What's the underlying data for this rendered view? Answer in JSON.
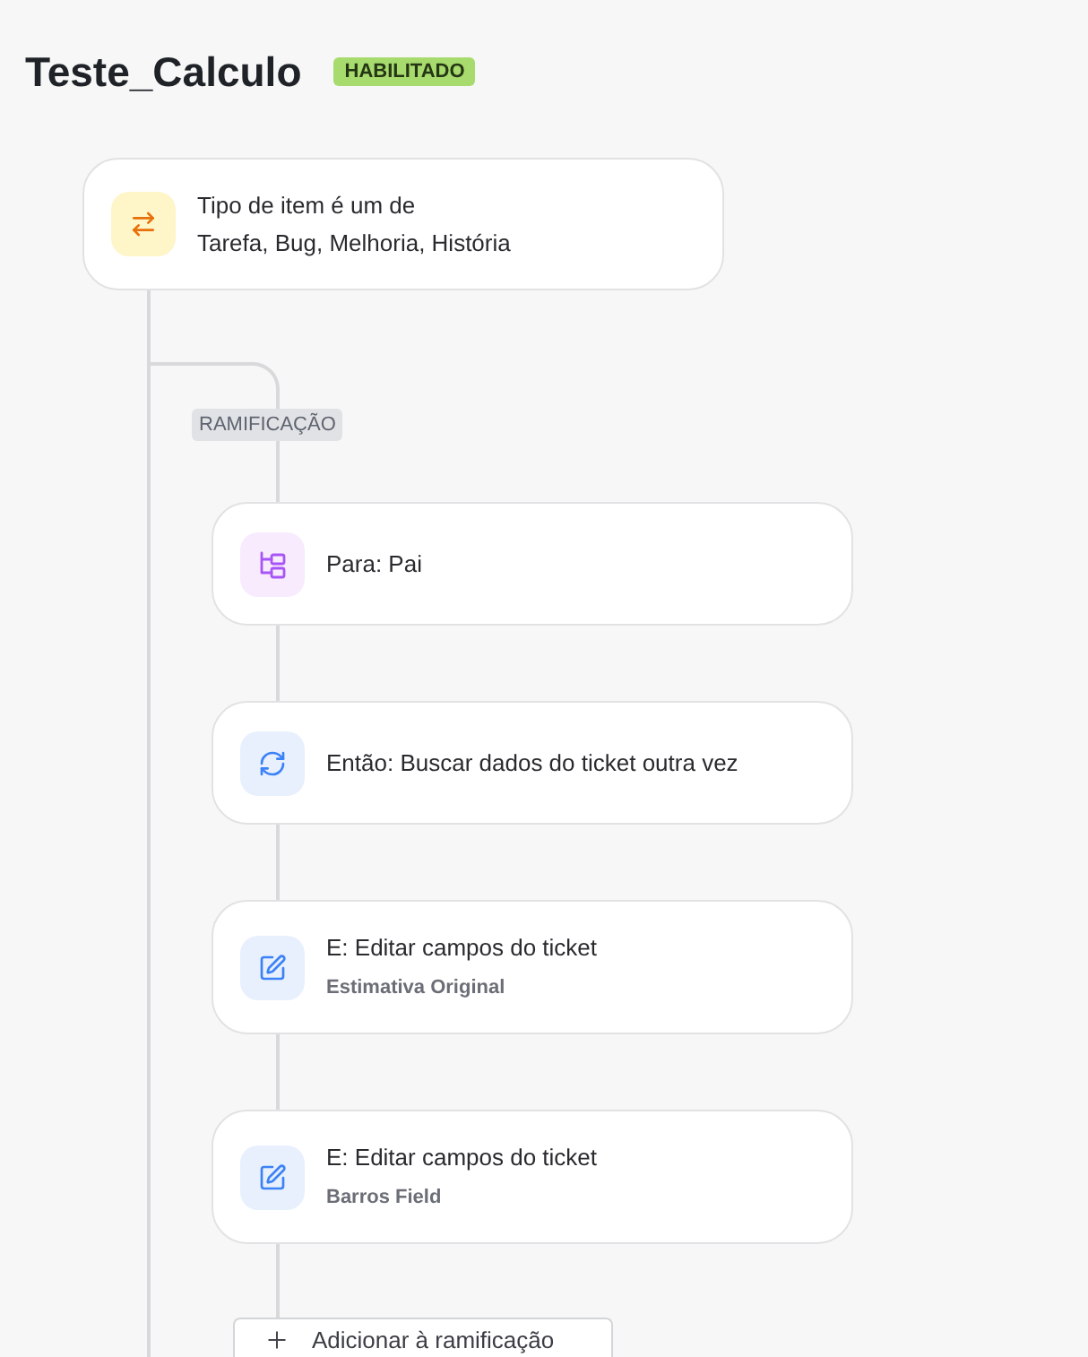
{
  "title": "Teste_Calculo",
  "status": {
    "label": "HABILITADO",
    "kind": "enabled"
  },
  "condition": {
    "kind": "condition",
    "title": "Tipo de item é um de",
    "detail": "Tarefa, Bug, Melhoria, História"
  },
  "branch": {
    "label": "RAMIFICAÇÃO",
    "steps": [
      {
        "kind": "branch_target",
        "title": "Para: Pai"
      },
      {
        "kind": "refetch",
        "title": "Então: Buscar dados do ticket outra vez"
      },
      {
        "kind": "edit",
        "title": "E: Editar campos do ticket",
        "detail": "Estimativa Original"
      },
      {
        "kind": "edit",
        "title": "E: Editar campos do ticket",
        "detail": "Barros Field"
      }
    ],
    "add_button": "Adicionar à ramificação"
  }
}
